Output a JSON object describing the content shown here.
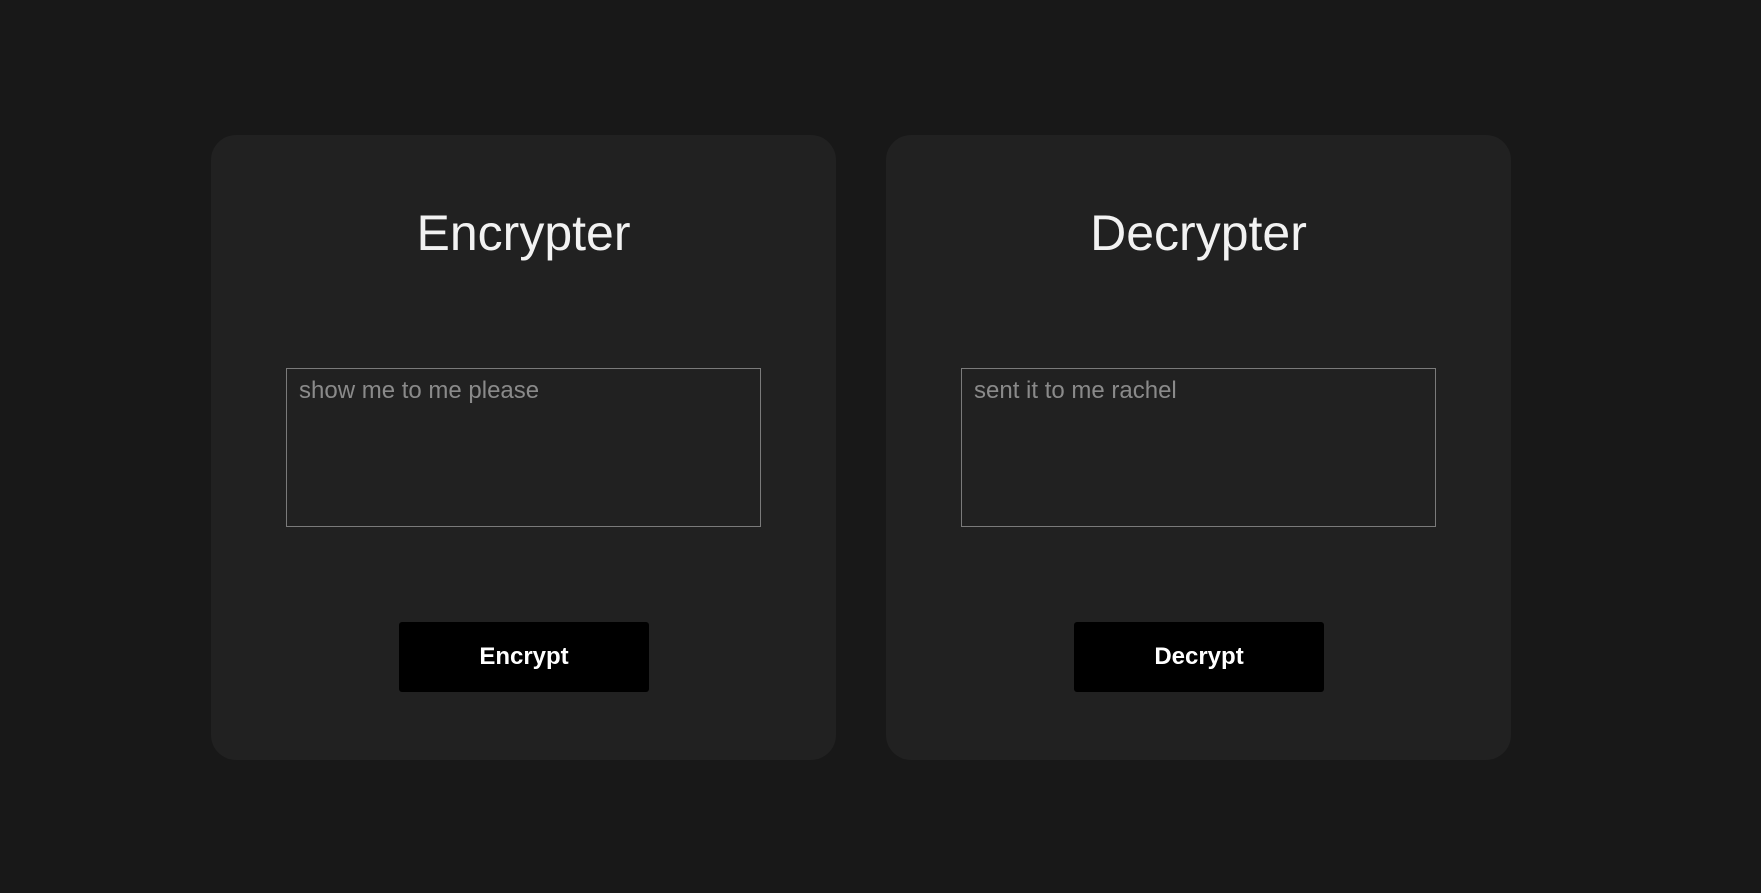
{
  "encrypter": {
    "title": "Encrypter",
    "input_placeholder": "show me to me please",
    "input_value": "",
    "button_label": "Encrypt"
  },
  "decrypter": {
    "title": "Decrypter",
    "input_placeholder": "sent it to me rachel",
    "input_value": "",
    "button_label": "Decrypt"
  },
  "colors": {
    "page_background": "#181818",
    "card_background": "#212121",
    "button_background": "#000000",
    "title_text": "#f2f2f2",
    "placeholder_text": "#8a8a8a",
    "input_border": "#7a7a7a"
  }
}
